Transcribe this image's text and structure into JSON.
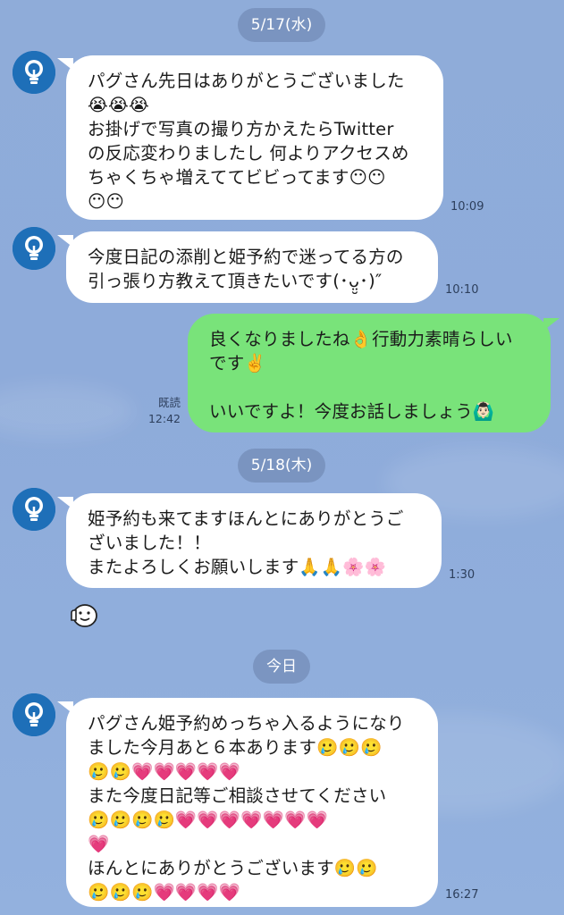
{
  "colors": {
    "background": "#8facd9",
    "incoming_bubble": "#ffffff",
    "outgoing_bubble": "#79e37a",
    "avatar": "#1e6fb8",
    "date_pill": "#6e86b0"
  },
  "avatar_icon": "lightbulb-icon",
  "dates": [
    "5/17(水)",
    "5/18(木)",
    "今日"
  ],
  "messages": [
    {
      "side": "incoming",
      "text": "パグさん先日はありがとうございました\n😭😭😭\nお掛げで写真の撮り方かえたらTwitter\nの反応変わりましたし 何よりアクセスめ\nちゃくちゃ増えててビビってます😶😶\n😶😶",
      "time": "10:09"
    },
    {
      "side": "incoming",
      "text": "今度日記の添削と姫予約で迷ってる方の\n引っ張り方教えて頂きたいです(･ᴗ̤̮･)″",
      "time": "10:10"
    },
    {
      "side": "outgoing",
      "text": "良くなりましたね👌行動力素晴らしい\nです✌️\n\nいいですよ！今度お話しましょう🙆🏻‍♂️",
      "read": "既読",
      "time": "12:42"
    },
    {
      "side": "incoming",
      "text": "姫予約も来てますほんとにありがとうご\nざいました！！\nまたよろしくお願いします🙏🙏🌸🌸",
      "time": "1:30"
    },
    {
      "side": "incoming",
      "text": "パグさん姫予約めっちゃ入るようになり\nました今月あと６本あります🥲🥲🥲\n🥲🥲💗💗💗💗💗\nまた今度日記等ご相談させてください\n🥲🥲🥲🥲💗💗💗💗💗💗💗\n💗\nほんとにありがとうございます🥲🥲\n🥲🥲🥲💗💗💗💗",
      "time": "16:27"
    }
  ],
  "sticker": "thumbs-up-blob-sticker"
}
